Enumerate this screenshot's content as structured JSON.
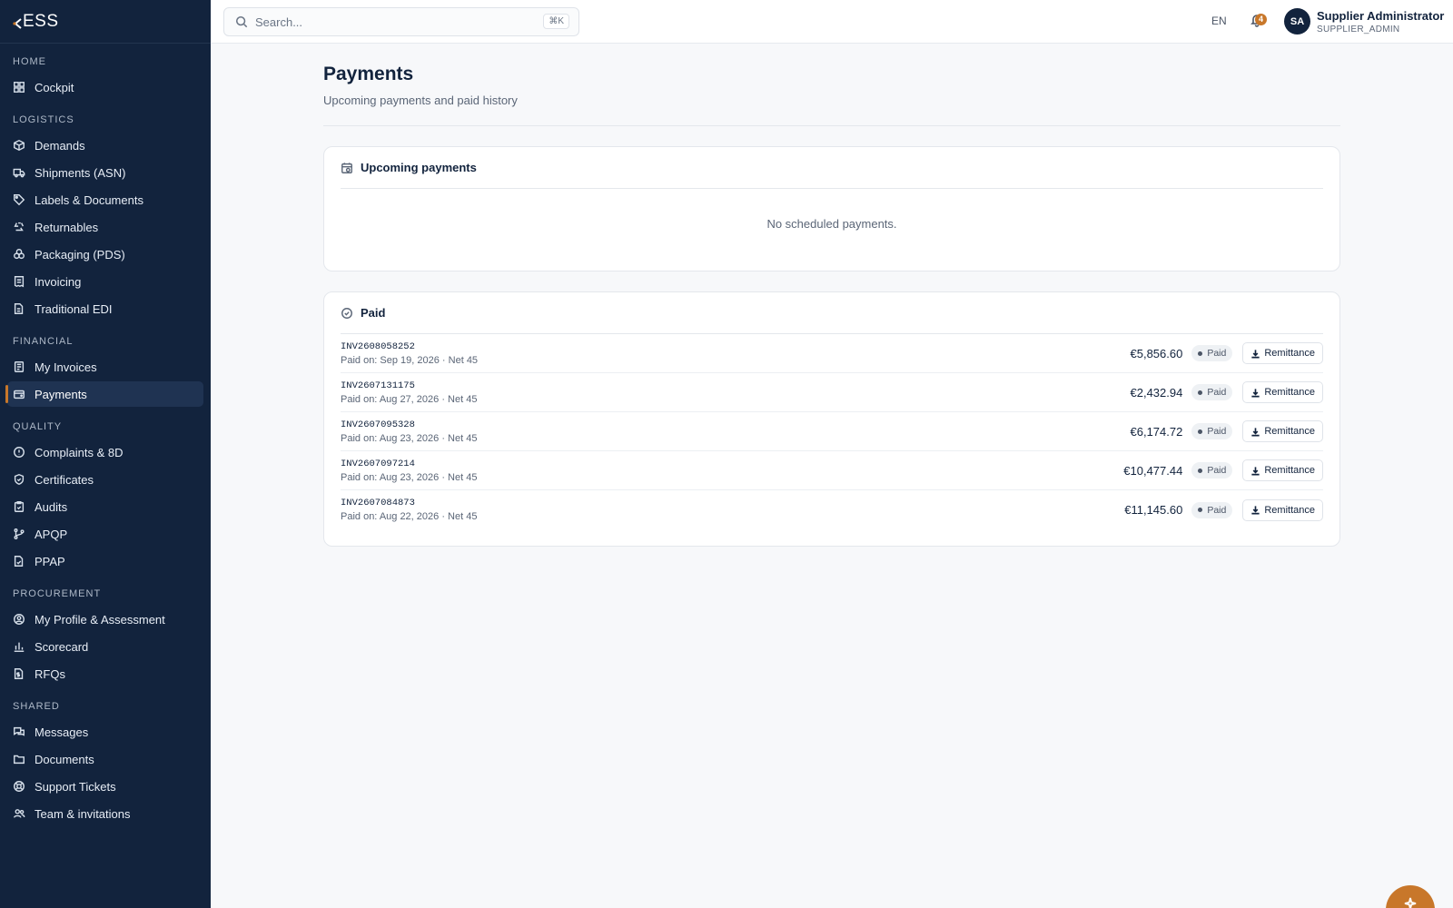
{
  "brand": {
    "logo_text": "ESS"
  },
  "sidebar": {
    "sections": [
      {
        "label": "HOME",
        "items": [
          {
            "label": "Cockpit",
            "icon": "dashboard-icon"
          }
        ]
      },
      {
        "label": "LOGISTICS",
        "items": [
          {
            "label": "Demands",
            "icon": "box-icon"
          },
          {
            "label": "Shipments (ASN)",
            "icon": "truck-icon"
          },
          {
            "label": "Labels & Documents",
            "icon": "tag-icon"
          },
          {
            "label": "Returnables",
            "icon": "recycle-icon"
          },
          {
            "label": "Packaging (PDS)",
            "icon": "packages-icon"
          },
          {
            "label": "Invoicing",
            "icon": "receipt-icon"
          },
          {
            "label": "Traditional EDI",
            "icon": "file-exchange-icon"
          }
        ]
      },
      {
        "label": "FINANCIAL",
        "items": [
          {
            "label": "My Invoices",
            "icon": "invoice-icon"
          },
          {
            "label": "Payments",
            "icon": "wallet-icon",
            "active": true
          }
        ]
      },
      {
        "label": "QUALITY",
        "items": [
          {
            "label": "Complaints & 8D",
            "icon": "alert-circle-icon"
          },
          {
            "label": "Certificates",
            "icon": "shield-check-icon"
          },
          {
            "label": "Audits",
            "icon": "clipboard-check-icon"
          },
          {
            "label": "APQP",
            "icon": "git-branch-icon"
          },
          {
            "label": "PPAP",
            "icon": "file-check-icon"
          }
        ]
      },
      {
        "label": "PROCUREMENT",
        "items": [
          {
            "label": "My Profile & Assessment",
            "icon": "user-circle-icon"
          },
          {
            "label": "Scorecard",
            "icon": "bar-chart-icon"
          },
          {
            "label": "RFQs",
            "icon": "file-dollar-icon"
          }
        ]
      },
      {
        "label": "SHARED",
        "items": [
          {
            "label": "Messages",
            "icon": "messages-icon"
          },
          {
            "label": "Documents",
            "icon": "folder-icon"
          },
          {
            "label": "Support Tickets",
            "icon": "lifebuoy-icon"
          },
          {
            "label": "Team & invitations",
            "icon": "users-icon"
          }
        ]
      }
    ]
  },
  "topbar": {
    "search_placeholder": "Search...",
    "search_shortcut": "⌘K",
    "language": "EN",
    "notification_count": "4",
    "avatar_initials": "SA",
    "user_name": "Supplier Administrator",
    "user_role": "SUPPLIER_ADMIN"
  },
  "page": {
    "title": "Payments",
    "subtitle": "Upcoming payments and paid history"
  },
  "upcoming": {
    "title": "Upcoming payments",
    "empty_text": "No scheduled payments."
  },
  "paid": {
    "title": "Paid",
    "rows": [
      {
        "invoice": "INV2608058252",
        "meta": "Paid on: Sep 19, 2026 · Net 45",
        "amount": "€5,856.60",
        "status": "Paid",
        "action": "Remittance"
      },
      {
        "invoice": "INV2607131175",
        "meta": "Paid on: Aug 27, 2026 · Net 45",
        "amount": "€2,432.94",
        "status": "Paid",
        "action": "Remittance"
      },
      {
        "invoice": "INV2607095328",
        "meta": "Paid on: Aug 23, 2026 · Net 45",
        "amount": "€6,174.72",
        "status": "Paid",
        "action": "Remittance"
      },
      {
        "invoice": "INV2607097214",
        "meta": "Paid on: Aug 23, 2026 · Net 45",
        "amount": "€10,477.44",
        "status": "Paid",
        "action": "Remittance"
      },
      {
        "invoice": "INV2607084873",
        "meta": "Paid on: Aug 22, 2026 · Net 45",
        "amount": "€11,145.60",
        "status": "Paid",
        "action": "Remittance"
      }
    ]
  },
  "colors": {
    "sidebar_bg": "#12233d",
    "accent": "#c8772a",
    "page_bg": "#f7f8fa"
  }
}
